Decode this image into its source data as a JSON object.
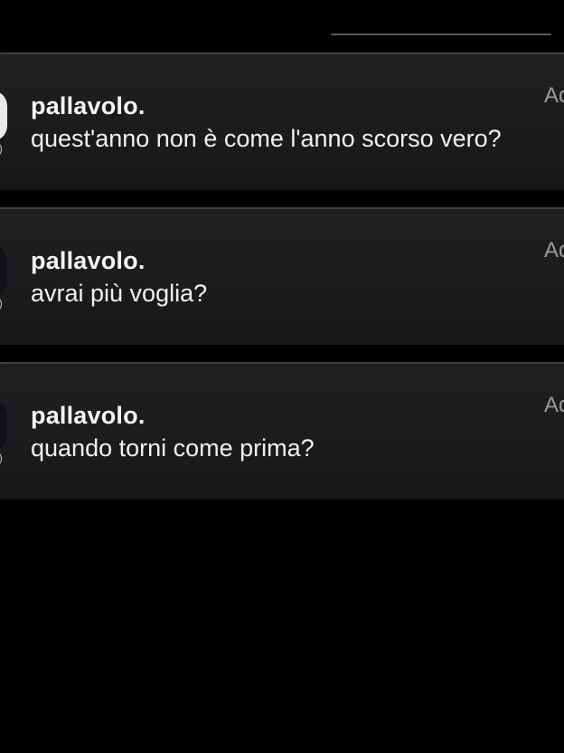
{
  "notifications": [
    {
      "sender": "pallavolo.",
      "message": "quest'anno non è come l'anno scorso vero?",
      "time": "Ad",
      "avatar_color": "#e9e9e9"
    },
    {
      "sender": "pallavolo.",
      "message": "avrai più voglia?",
      "time": "Ad",
      "avatar_color": "#0f1114"
    },
    {
      "sender": "pallavolo.",
      "message": "quando torni come prima?",
      "time": "Ad",
      "avatar_color": "#0f1114"
    }
  ],
  "colors": {
    "background": "#000000",
    "card": "#1e1f21",
    "card_border": "#3e3f42",
    "time_text": "#9a9a9c"
  },
  "icons": {
    "app_badge": "app-badge-icon",
    "avatar": "avatar"
  }
}
